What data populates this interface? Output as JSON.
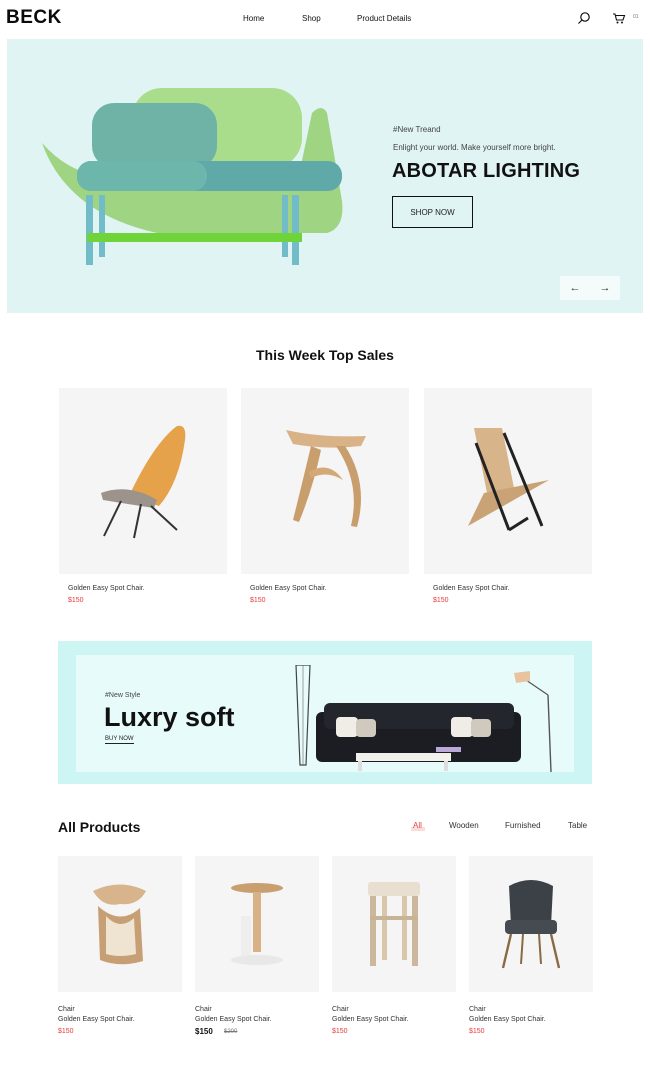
{
  "header": {
    "logo": "BECK",
    "nav": [
      "Home",
      "Shop",
      "Product Details"
    ],
    "cart_count": "01",
    "icons": [
      "search-icon",
      "cart-icon"
    ]
  },
  "hero": {
    "tag": "#New Treand",
    "subtitle": "Enlight your world. Make yourself more bright.",
    "title": "ABOTAR LIGHTING",
    "button": "SHOP NOW",
    "background": "#dff4f3",
    "arrows": [
      "←",
      "→"
    ]
  },
  "top_sales": {
    "title": "This Week Top Sales",
    "items": [
      {
        "name": "Golden Easy Spot Chair.",
        "price": "$150"
      },
      {
        "name": "Golden Easy Spot Chair.",
        "price": "$150"
      },
      {
        "name": "Golden Easy Spot Chair.",
        "price": "$150"
      }
    ]
  },
  "promo": {
    "tag": "#New Style",
    "title": "Luxry soft",
    "link": "BUY NOW",
    "background": "#cdf5f3"
  },
  "all_products": {
    "title": "All Products",
    "filters": [
      "All",
      "Wooden",
      "Furnished",
      "Table"
    ],
    "items": [
      {
        "category": "Chair",
        "name": "Golden Easy Spot Chair.",
        "price": "$150"
      },
      {
        "category": "Chair",
        "name": "Golden Easy Spot Chair.",
        "price": "$150",
        "old_price": "$200"
      },
      {
        "category": "Chair",
        "name": "Golden Easy Spot Chair.",
        "price": "$150"
      },
      {
        "category": "Chair",
        "name": "Golden Easy Spot Chair.",
        "price": "$150"
      }
    ]
  },
  "colors": {
    "accent_price": "#e0403c",
    "text": "#111111",
    "card_bg": "#f5f5f5"
  }
}
